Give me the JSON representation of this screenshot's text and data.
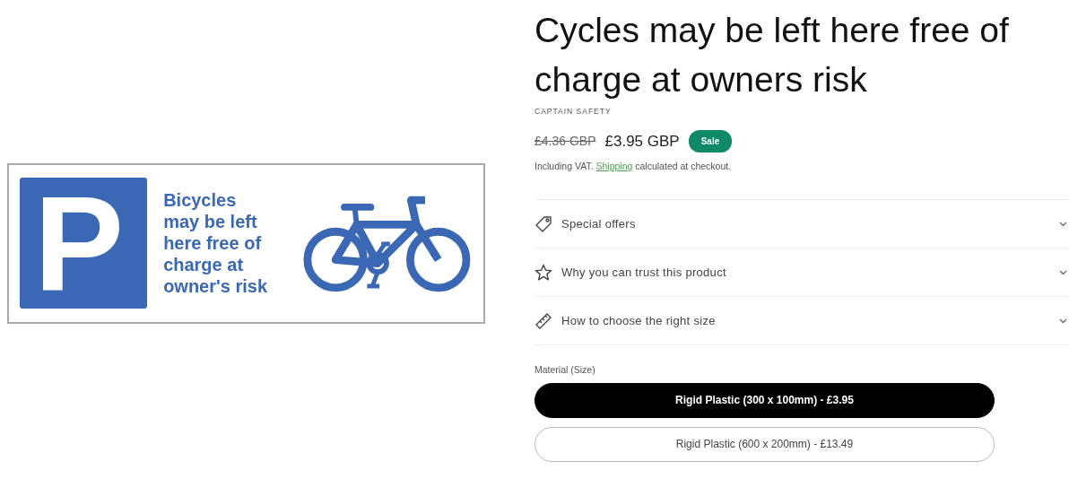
{
  "product_image": {
    "symbol": "P",
    "lines": [
      "Bicycles",
      "may be left",
      "here free of",
      "charge at",
      "owner's risk"
    ]
  },
  "title": "Cycles may be left here free of charge at owners risk",
  "vendor": "CAPTAIN SAFETY",
  "price": {
    "regular": "£4.36 GBP",
    "sale": "£3.95 GBP",
    "badge": "Sale"
  },
  "tax_note": {
    "before": "Including VAT.",
    "link": "Shipping",
    "after": "calculated at checkout."
  },
  "accordions": [
    {
      "kind": "tag",
      "label": "Special offers",
      "expanded": false
    },
    {
      "kind": "star",
      "label": "Why you can trust this product",
      "expanded": false
    },
    {
      "kind": "ruler",
      "label": "How to choose the right size",
      "expanded": false
    }
  ],
  "variant_picker": {
    "label": "Material (Size)",
    "options": [
      {
        "label": "Rigid Plastic (300 x 100mm) - £3.95",
        "selected": true
      },
      {
        "label": "Rigid Plastic (600 x 200mm) - £13.49",
        "selected": false
      }
    ]
  }
}
